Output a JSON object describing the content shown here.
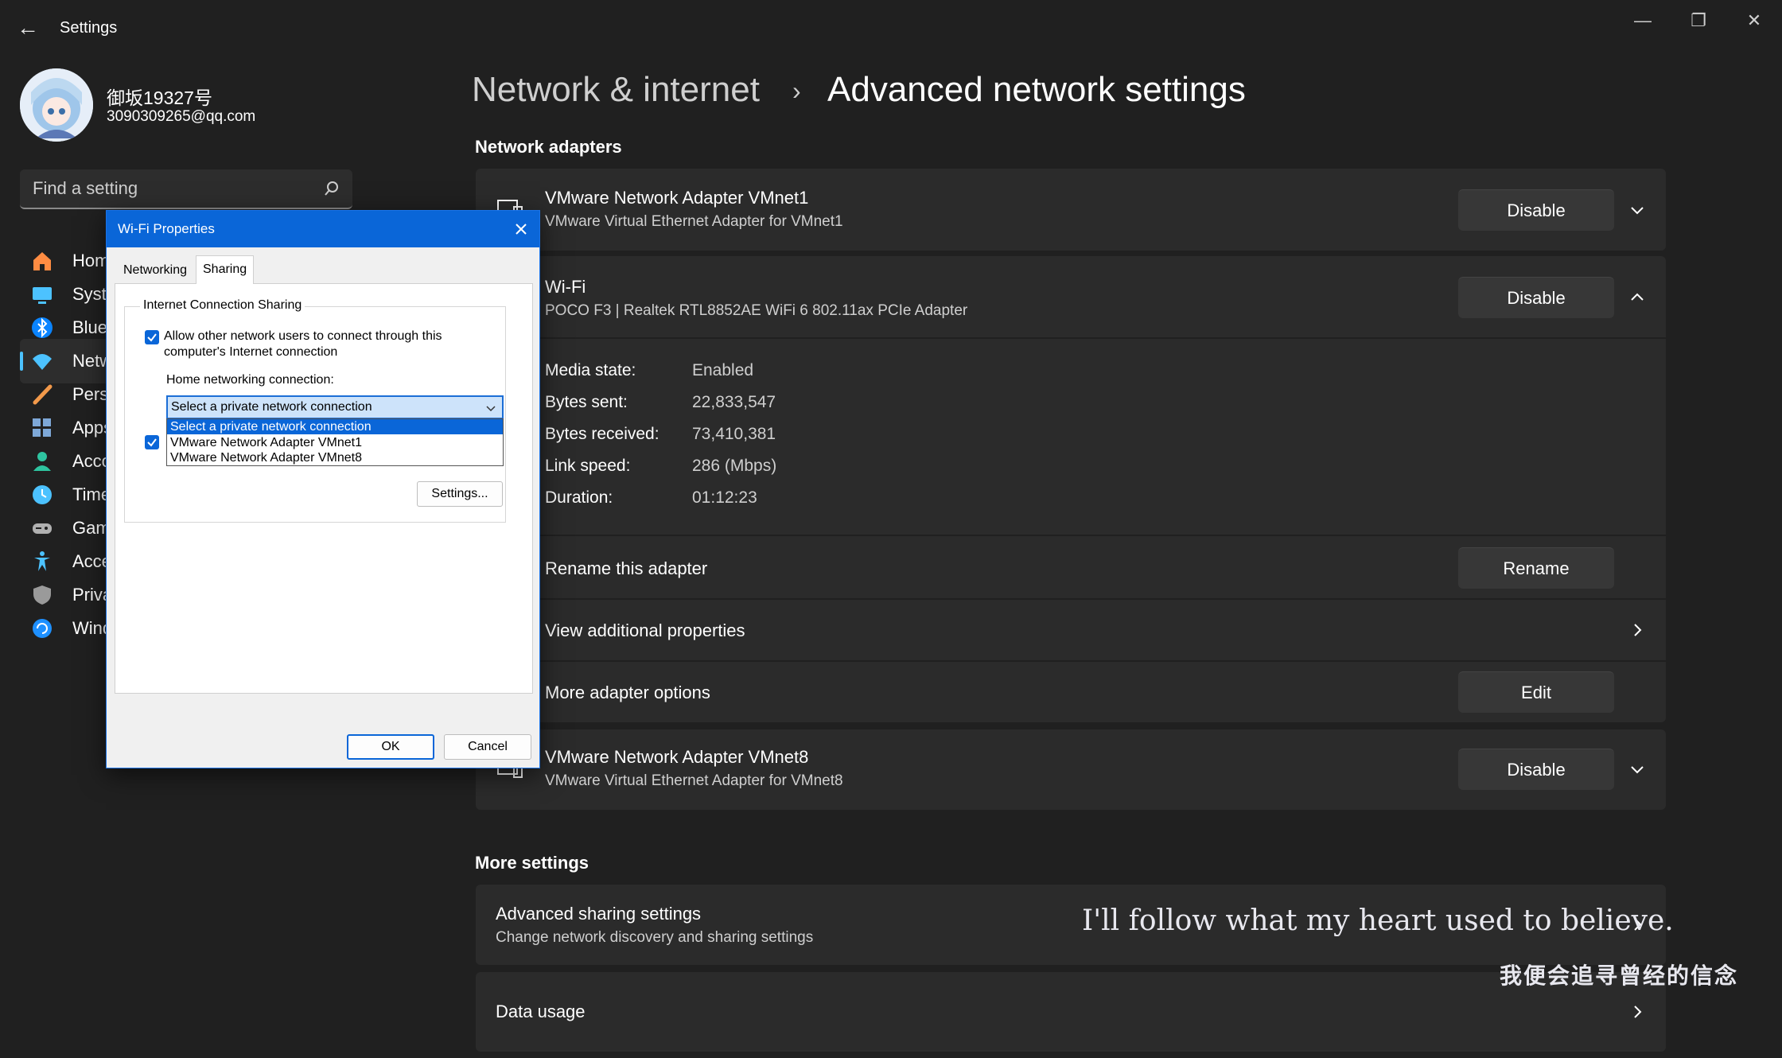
{
  "window": {
    "title": "Settings",
    "back_glyph": "←",
    "min_glyph": "—",
    "max_glyph": "❐",
    "close_glyph": "✕"
  },
  "profile": {
    "name": "御坂19327号",
    "email": "3090309265@qq.com"
  },
  "search": {
    "placeholder": "Find a setting"
  },
  "nav": [
    {
      "label": "Home",
      "icon": "home-icon",
      "color": "#ff8c42"
    },
    {
      "label": "System",
      "icon": "display-icon",
      "color": "#4cc2ff"
    },
    {
      "label": "Bluetooth & devices",
      "icon": "bluetooth-icon",
      "color": "#0a84ff"
    },
    {
      "label": "Network & internet",
      "icon": "wifi-icon",
      "color": "#4cc2ff",
      "active": true
    },
    {
      "label": "Personalization",
      "icon": "brush-icon",
      "color": "#f2994a"
    },
    {
      "label": "Apps",
      "icon": "apps-icon",
      "color": "#7ea8d8"
    },
    {
      "label": "Accounts",
      "icon": "person-icon",
      "color": "#2ec4a0"
    },
    {
      "label": "Time & language",
      "icon": "clock-icon",
      "color": "#4cc2ff"
    },
    {
      "label": "Gaming",
      "icon": "gamepad-icon",
      "color": "#b0b0b0"
    },
    {
      "label": "Accessibility",
      "icon": "accessibility-icon",
      "color": "#4cc2ff"
    },
    {
      "label": "Privacy & security",
      "icon": "shield-icon",
      "color": "#9a9a9a"
    },
    {
      "label": "Windows Update",
      "icon": "refresh-icon",
      "color": "#1e90ff"
    }
  ],
  "breadcrumb": {
    "parent": "Network & internet",
    "separator": "›",
    "current": "Advanced network settings"
  },
  "sections": {
    "adapters_title": "Network adapters",
    "more_title": "More settings"
  },
  "adapters": {
    "vmnet1": {
      "name": "VMware Network Adapter VMnet1",
      "desc": "VMware Virtual Ethernet Adapter for VMnet1",
      "button": "Disable"
    },
    "wifi": {
      "name": "Wi-Fi",
      "desc": "POCO F3 | Realtek RTL8852AE WiFi 6 802.11ax PCIe Adapter",
      "button": "Disable",
      "props": [
        {
          "label": "Media state:",
          "value": "Enabled"
        },
        {
          "label": "Bytes sent:",
          "value": "22,833,547"
        },
        {
          "label": "Bytes received:",
          "value": "73,410,381"
        },
        {
          "label": "Link speed:",
          "value": "286 (Mbps)"
        },
        {
          "label": "Duration:",
          "value": "01:12:23"
        }
      ],
      "rename_label": "Rename this adapter",
      "rename_button": "Rename",
      "view_props_label": "View additional properties",
      "more_options_label": "More adapter options",
      "edit_button": "Edit"
    },
    "vmnet8": {
      "name": "VMware Network Adapter VMnet8",
      "desc": "VMware Virtual Ethernet Adapter for VMnet8",
      "button": "Disable"
    }
  },
  "more_settings": {
    "sharing": {
      "title": "Advanced sharing settings",
      "desc": "Change network discovery and sharing settings"
    },
    "data_usage": {
      "title": "Data usage"
    }
  },
  "dialog": {
    "title": "Wi-Fi Properties",
    "tabs": [
      "Networking",
      "Sharing"
    ],
    "active_tab": "Sharing",
    "group_label": "Internet Connection Sharing",
    "allow_label": "Allow other network users to connect through this computer's Internet connection",
    "allow_checked": true,
    "home_label": "Home networking connection:",
    "combo_value": "Select a private network connection",
    "options": [
      "Select a private network connection",
      "VMware Network Adapter VMnet1",
      "VMware Network Adapter VMnet8"
    ],
    "second_checked": true,
    "settings_button": "Settings...",
    "ok_button": "OK",
    "cancel_button": "Cancel"
  },
  "overlay": {
    "lyric_en": "I'll follow what my heart used to believe.",
    "lyric_zh": "我便会追寻曾经的信念"
  },
  "colors": {
    "background": "#202020",
    "card": "#2b2b2b",
    "accent": "#4cc2ff",
    "dialog_titlebar": "#0a66d8"
  }
}
